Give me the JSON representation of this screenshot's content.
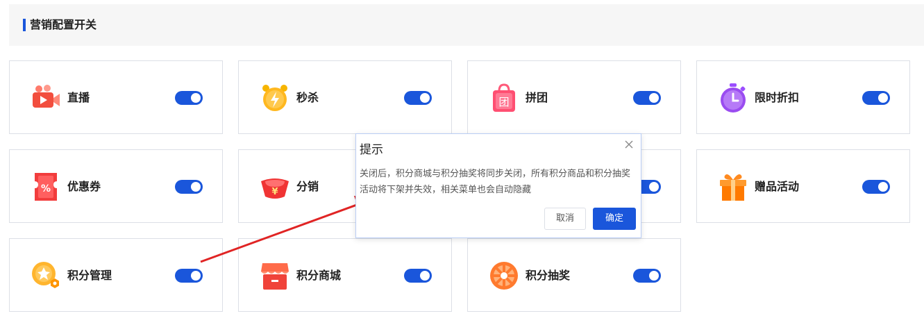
{
  "section": {
    "title": "营销配置开关"
  },
  "cards": [
    {
      "label": "直播",
      "icon": "live-video-icon",
      "enabled": true
    },
    {
      "label": "秒杀",
      "icon": "alarm-clock-icon",
      "enabled": true
    },
    {
      "label": "拼团",
      "icon": "group-bag-icon",
      "enabled": true,
      "icon_text": "团"
    },
    {
      "label": "限时折扣",
      "icon": "stopwatch-icon",
      "enabled": true
    },
    {
      "label": "优惠券",
      "icon": "coupon-icon",
      "enabled": true,
      "icon_text": "%"
    },
    {
      "label": "分销",
      "icon": "ingot-icon",
      "enabled": true,
      "icon_text": "¥"
    },
    {
      "label": "赠品活动",
      "icon": "gift-icon",
      "enabled": true
    },
    {
      "label": "积分管理",
      "icon": "points-star-icon",
      "enabled": true
    },
    {
      "label": "积分商城",
      "icon": "store-icon",
      "enabled": true
    },
    {
      "label": "积分抽奖",
      "icon": "lottery-wheel-icon",
      "enabled": true
    }
  ],
  "dialog": {
    "title": "提示",
    "message": "关闭后，积分商城与积分抽奖将同步关闭，所有积分商品和积分抽奖活动将下架并失效，相关菜单也会自动隐藏",
    "cancel_label": "取消",
    "confirm_label": "确定"
  },
  "colors": {
    "accent": "#1a56db",
    "annotation_arrow": "#e02424"
  }
}
